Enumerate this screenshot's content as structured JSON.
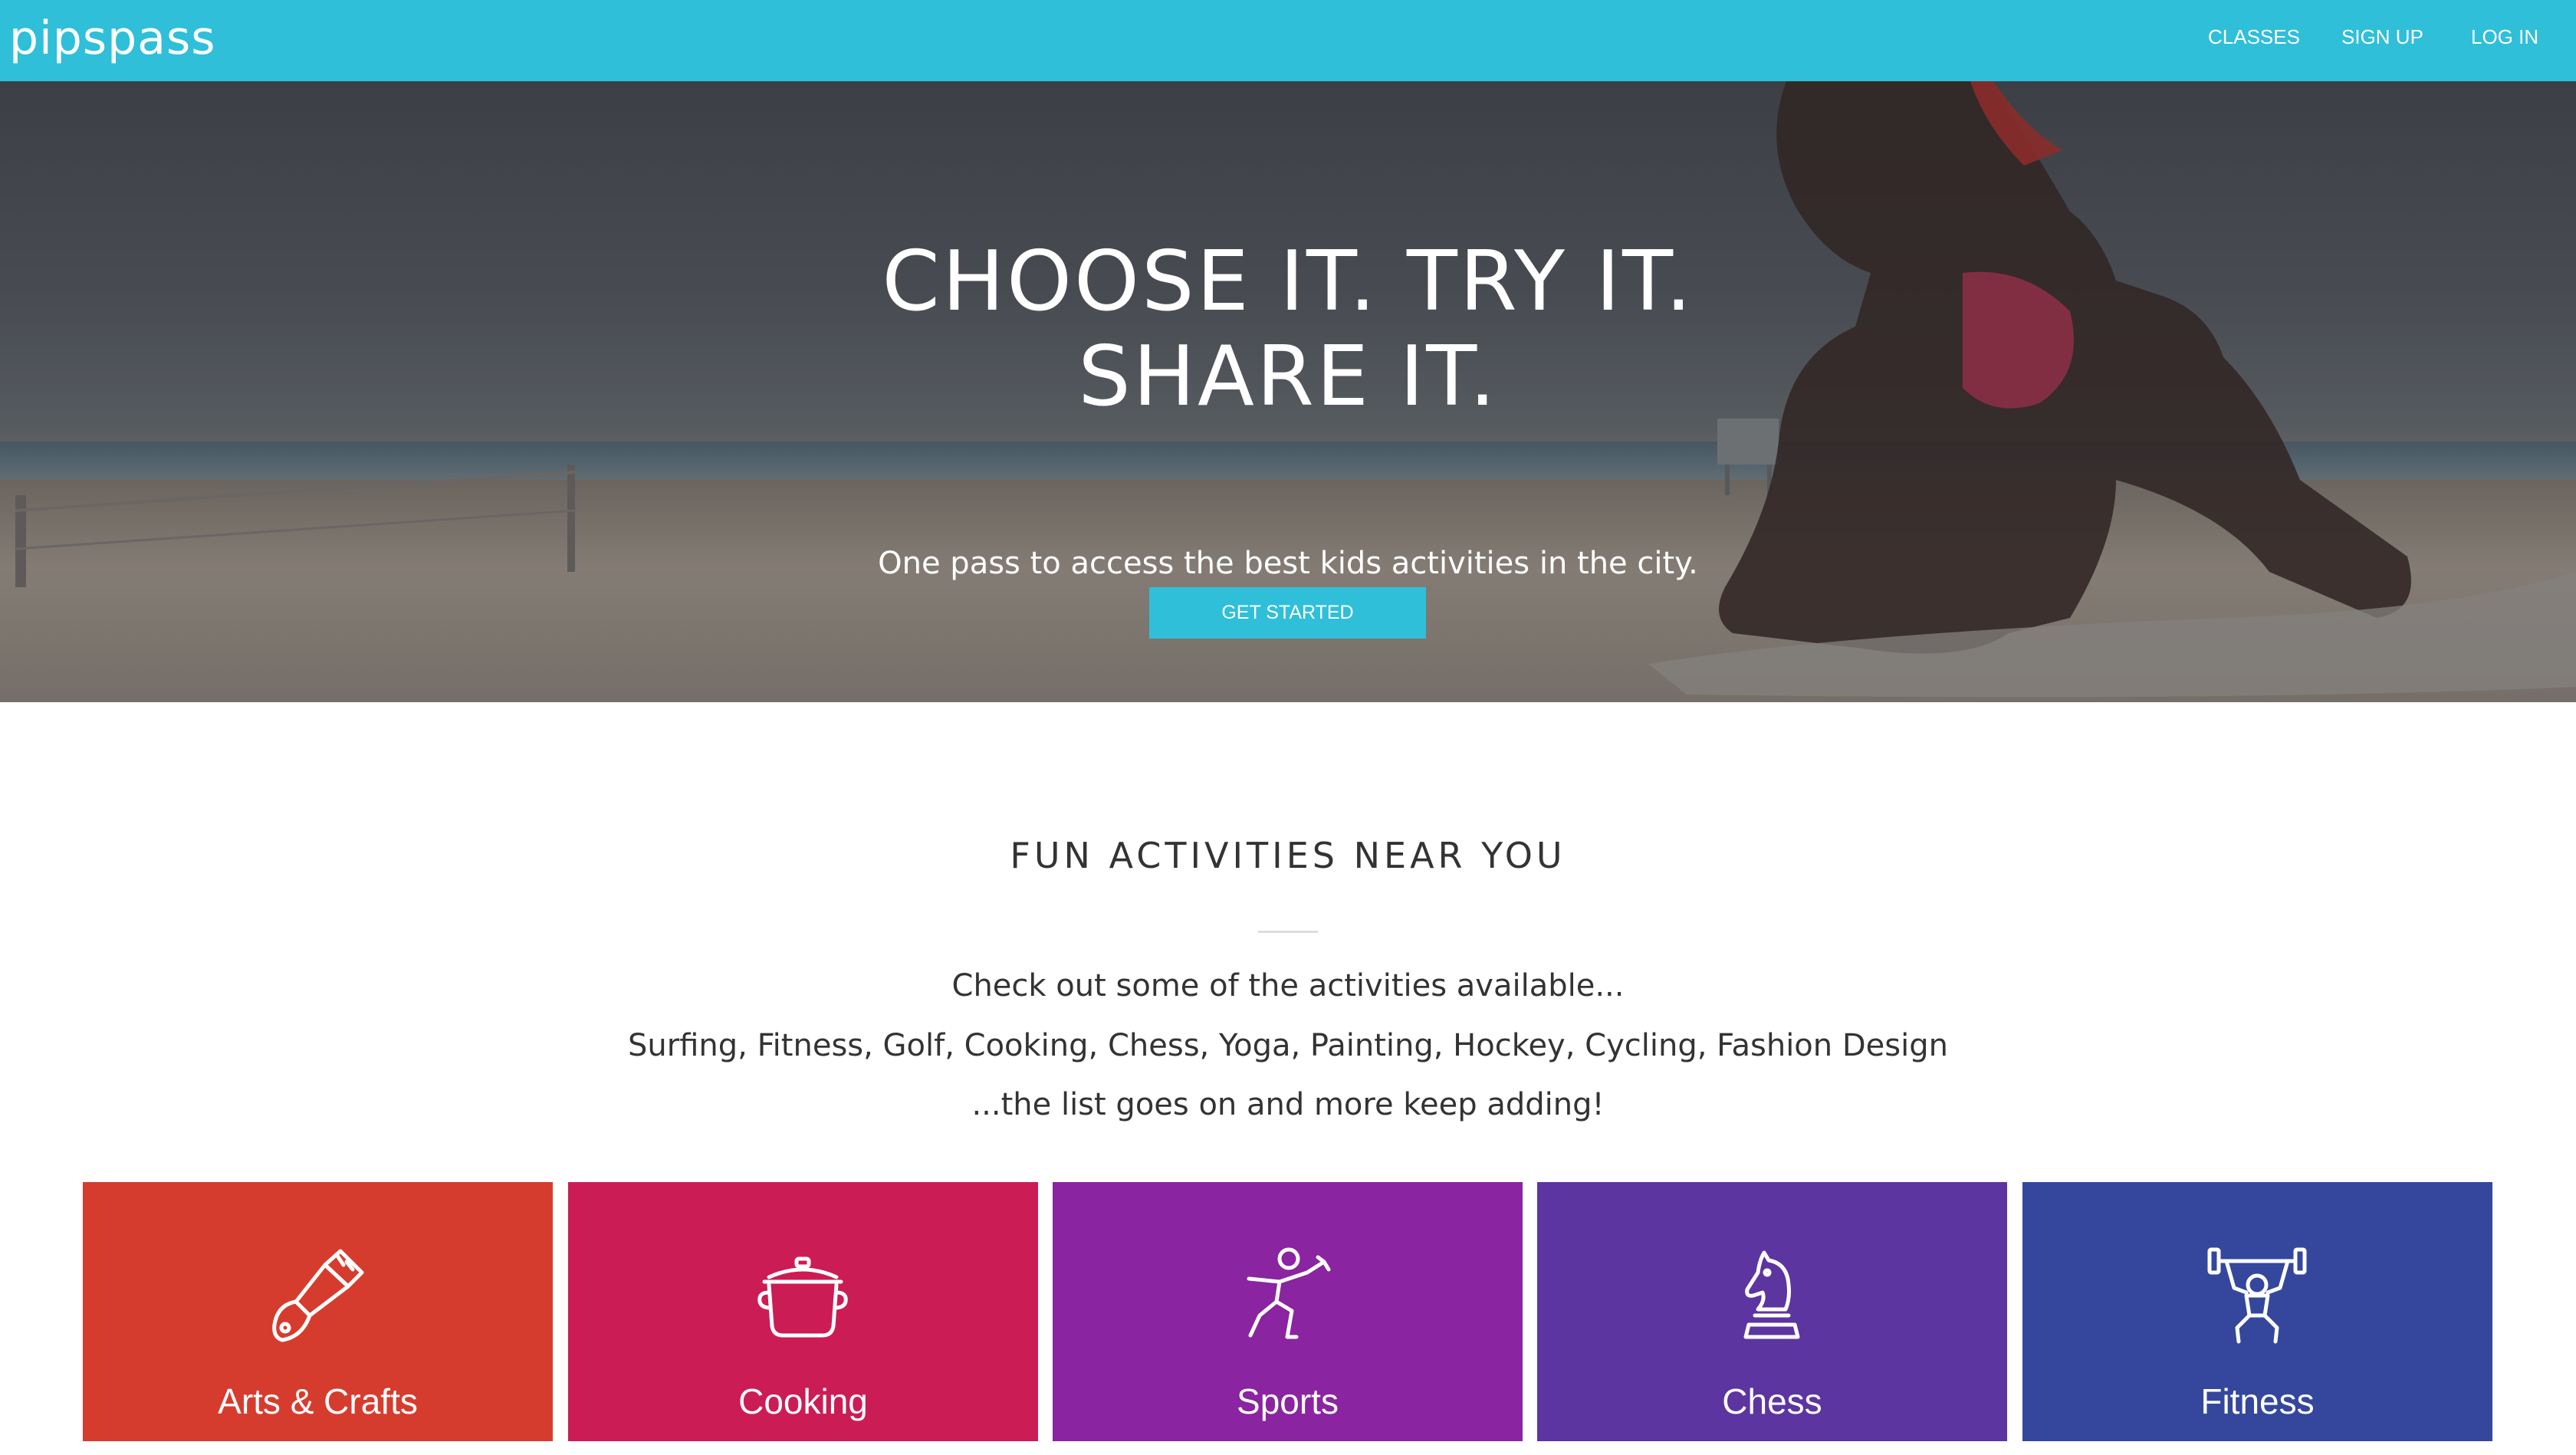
{
  "brand": {
    "logo_text": "pipspass",
    "colors": {
      "primary": "#2fbfd9",
      "arts": "#d63c2e",
      "cooking": "#cc1c55",
      "sports": "#8a24a0",
      "chess": "#5c35a0",
      "fitness": "#35479c"
    }
  },
  "nav": {
    "classes": "CLASSES",
    "signup": "SIGN UP",
    "login": "LOG IN"
  },
  "hero": {
    "title_line1": "CHOOSE IT. TRY IT.",
    "title_line2": "SHARE IT.",
    "subtitle": "One pass to access the best kids activities in the city.",
    "cta": "GET STARTED"
  },
  "activities": {
    "title": "FUN ACTIVITIES NEAR YOU",
    "line1": "Check out some of the activities available...",
    "line2": "Surfing, Fitness, Golf, Cooking, Chess, Yoga, Painting, Hockey, Cycling, Fashion Design",
    "line3": "...the list goes on and more keep adding!",
    "cards": [
      {
        "label": "Arts & Crafts",
        "icon": "paintbrush-icon"
      },
      {
        "label": "Cooking",
        "icon": "cooking-pot-icon"
      },
      {
        "label": "Sports",
        "icon": "running-person-icon"
      },
      {
        "label": "Chess",
        "icon": "chess-knight-icon"
      },
      {
        "label": "Fitness",
        "icon": "weightlifter-icon"
      }
    ]
  }
}
